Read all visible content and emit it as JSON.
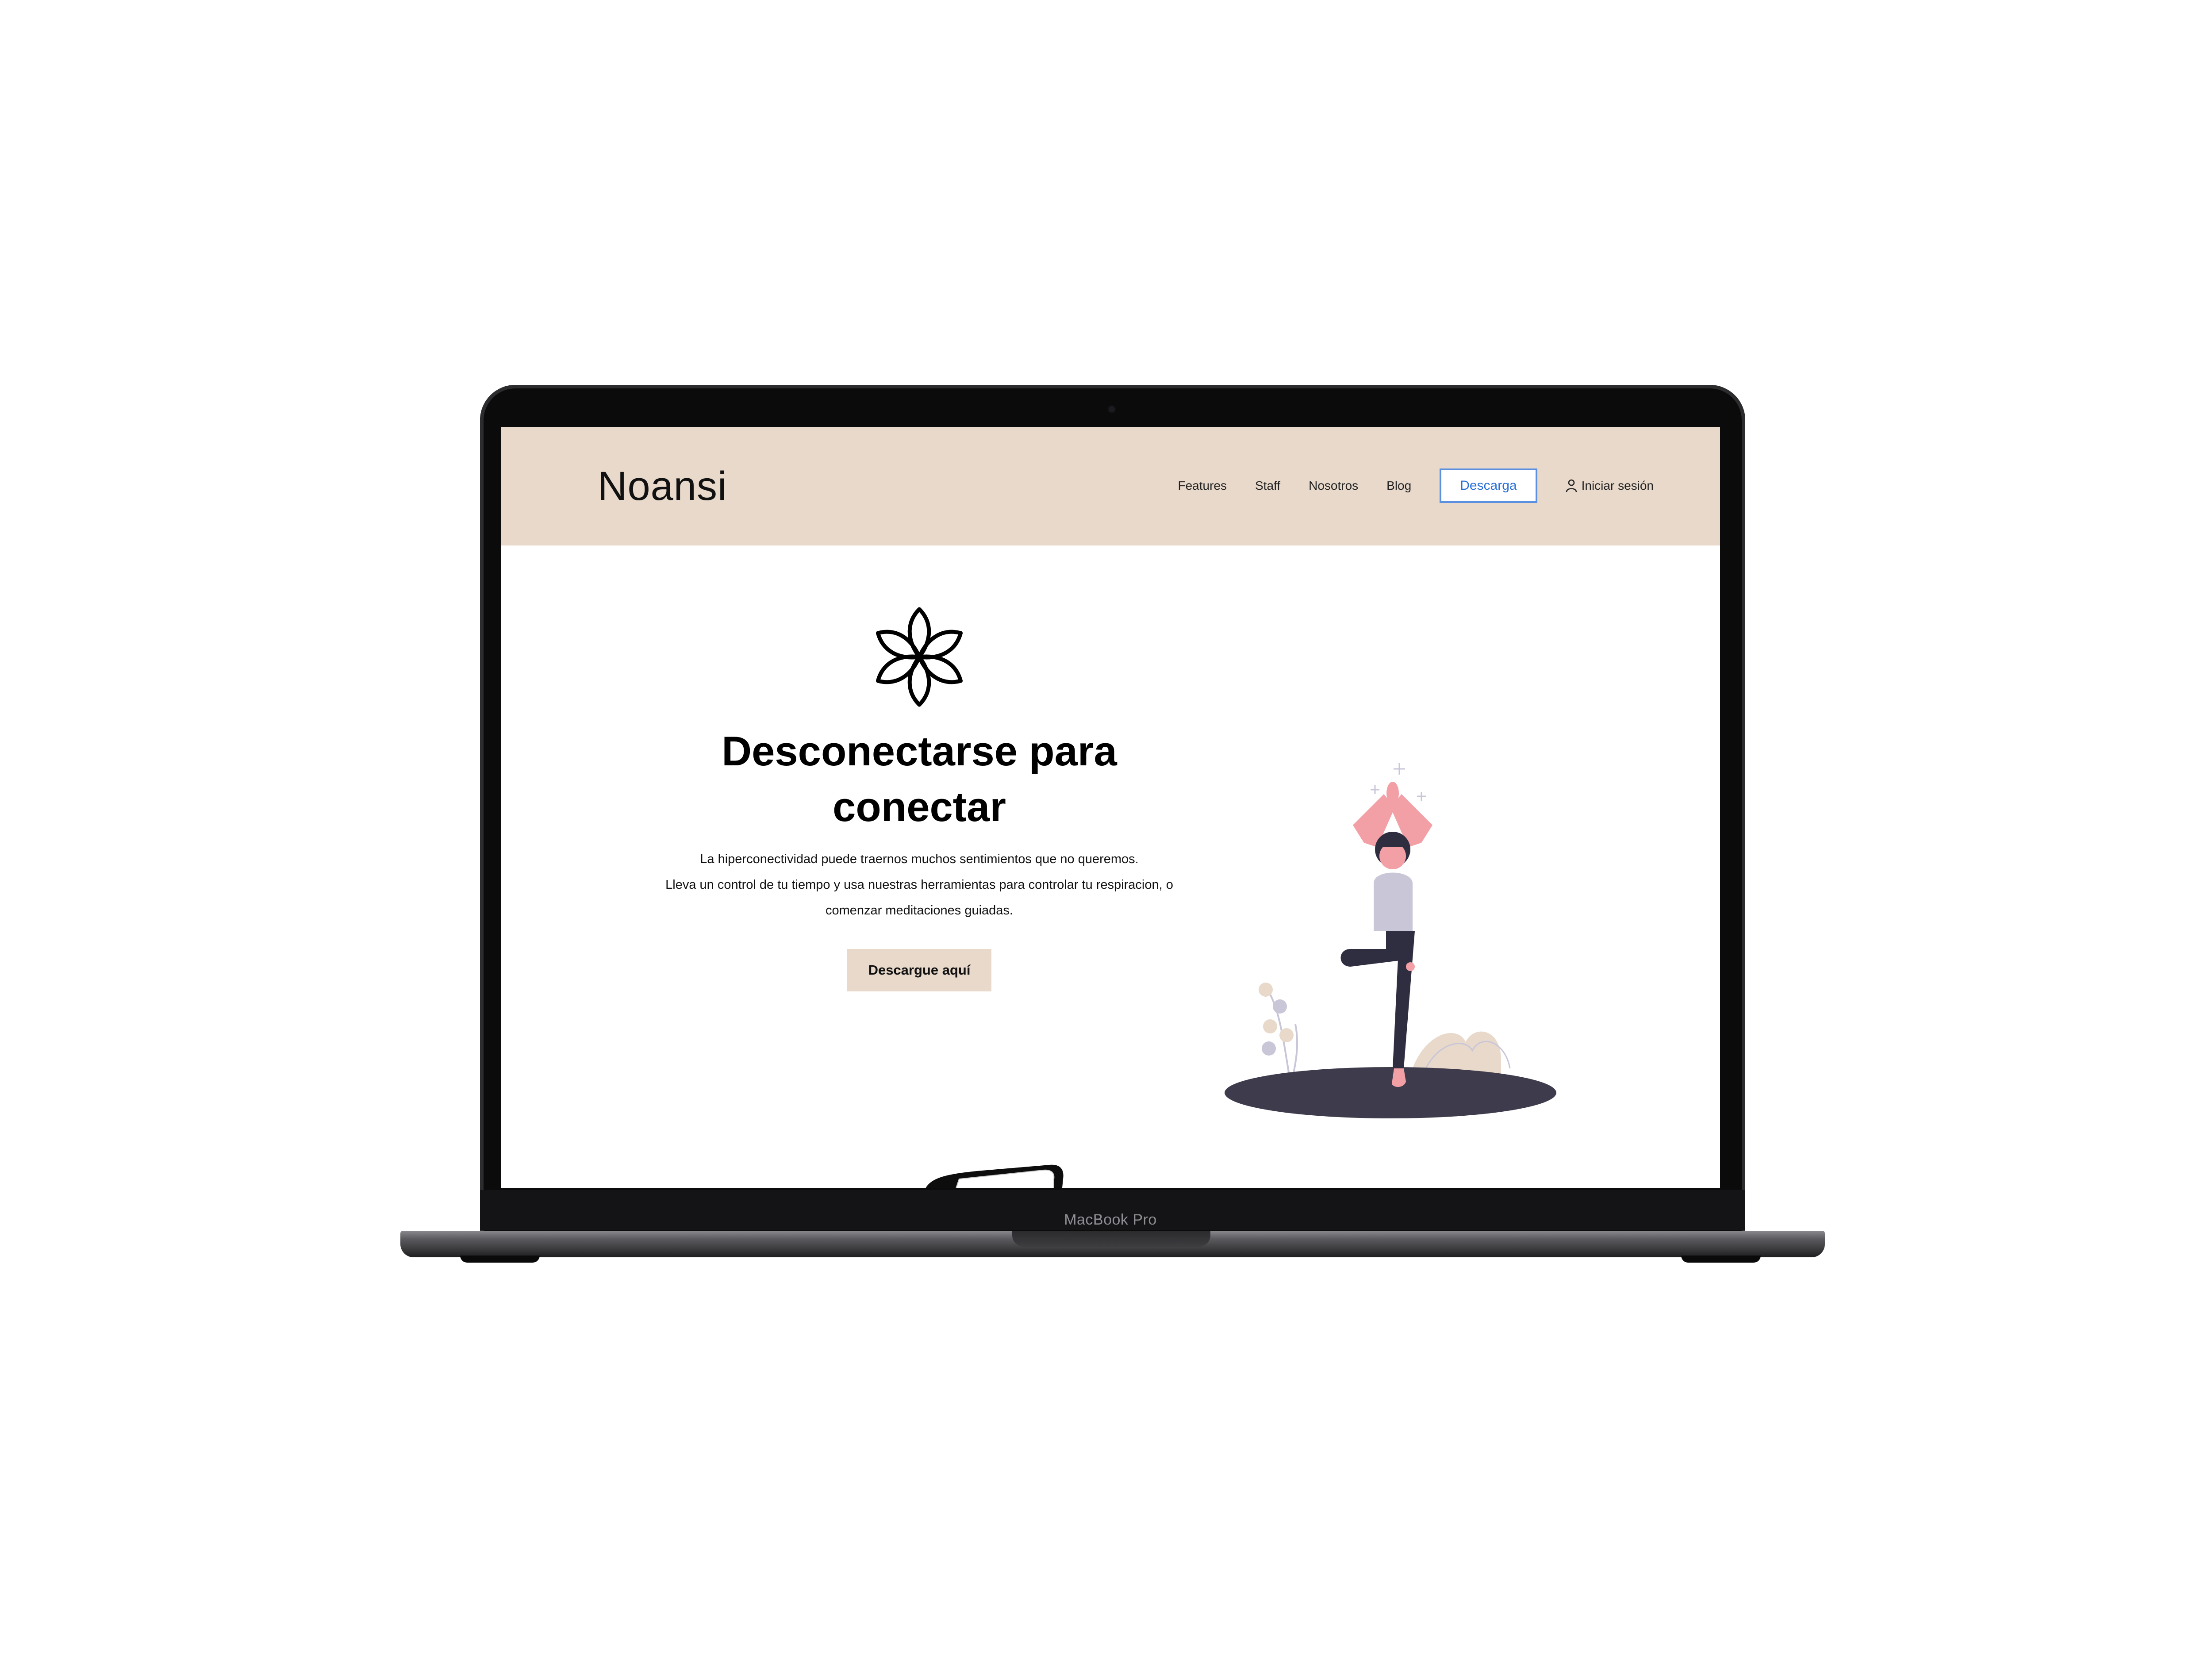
{
  "device": {
    "model_label": "MacBook Pro"
  },
  "header": {
    "logo": "Noansi",
    "nav": [
      {
        "label": "Features"
      },
      {
        "label": "Staff"
      },
      {
        "label": "Nosotros"
      },
      {
        "label": "Blog"
      }
    ],
    "cta_label": "Descarga",
    "login_label": "Iniciar sesión",
    "login_icon": "user-icon"
  },
  "hero": {
    "icon": "lotus-icon",
    "title_line1": "Desconectarse para",
    "title_line2": "conectar",
    "desc_line1": "La hiperconectividad puede traernos muchos sentimientos que no queremos.",
    "desc_line2": "Lleva un control de tu tiempo y usa nuestras herramientas para controlar tu respiracion, o",
    "desc_line3": "comenzar meditaciones guiadas.",
    "button_label": "Descargue aquí",
    "illustration": "yoga-woman-illustration"
  },
  "colors": {
    "header_bg": "#e8d9cb",
    "button_bg": "#e8d9cb",
    "cta_text": "#2a6fd6",
    "text": "#111111"
  }
}
